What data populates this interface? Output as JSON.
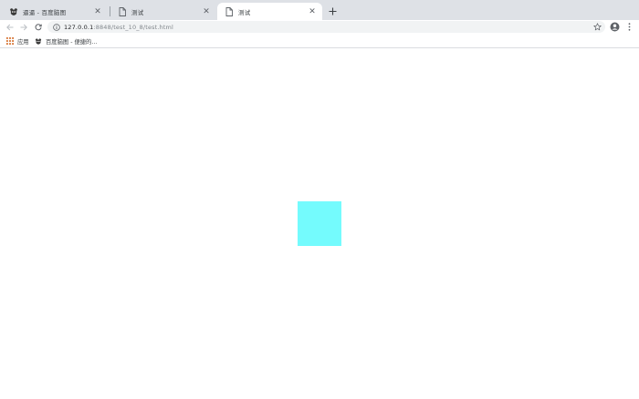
{
  "tabs": [
    {
      "title": "逼逼 - 百度脑图",
      "favicon": "baidu-naotu-icon",
      "active": false
    },
    {
      "title": "测试",
      "favicon": "page-icon",
      "active": false
    },
    {
      "title": "测试",
      "favicon": "page-icon",
      "active": true
    }
  ],
  "toolbar": {
    "url_host": "127.0.0.1",
    "url_path": ":8848/test_10_8/test.html"
  },
  "bookmarks": [
    {
      "label": "应用",
      "icon": "apps-grid-icon"
    },
    {
      "label": "百度脑图 - 便捷的...",
      "icon": "baidu-naotu-icon"
    }
  ],
  "page": {
    "box_color": "#74fbfd"
  },
  "colors": {
    "tabstrip": "#dee1e6",
    "omnibox": "#f1f3f4",
    "apps_grid": "#d56e2a"
  }
}
